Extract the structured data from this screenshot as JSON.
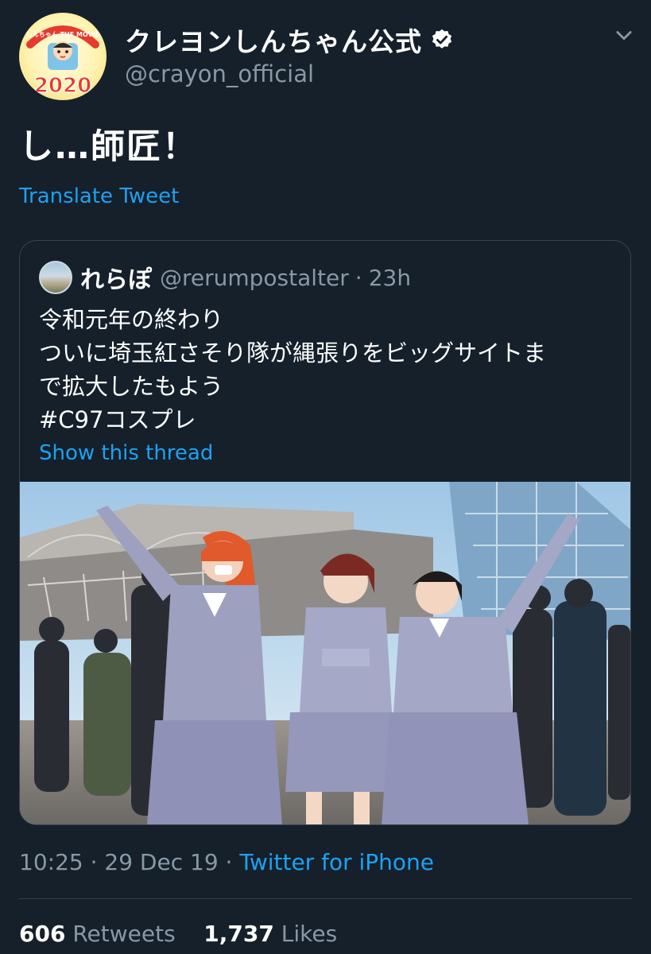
{
  "tweet": {
    "display_name": "クレヨンしんちゃん公式",
    "handle": "@crayon_official",
    "text": "し…師匠！",
    "translate_label": "Translate Tweet",
    "timestamp": "10:25 · 29 Dec 19",
    "separator": " · ",
    "source": "Twitter for iPhone",
    "retweets_count": "606",
    "retweets_label": "Retweets",
    "likes_count": "1,737",
    "likes_label": "Likes"
  },
  "avatar": {
    "banner_text": "しんちゃん THE MOVIE",
    "year_text": "2020"
  },
  "quoted_tweet": {
    "display_name": "れらぽ",
    "handle": "@rerumpostalter",
    "dot": "·",
    "time": "23h",
    "lines": [
      "令和元年の終わり",
      "ついに埼玉紅さそり隊が縄張りをビッグサイトま",
      "で拡大したもよう",
      "#C97コスプレ"
    ],
    "show_thread_label": "Show this thread"
  },
  "icons": {
    "verified": "verified-badge-icon",
    "menu": "chevron-down-icon"
  },
  "colors": {
    "background": "#15202b",
    "link": "#1da1f2",
    "secondary_text": "#8899a6",
    "border": "#38444d"
  }
}
